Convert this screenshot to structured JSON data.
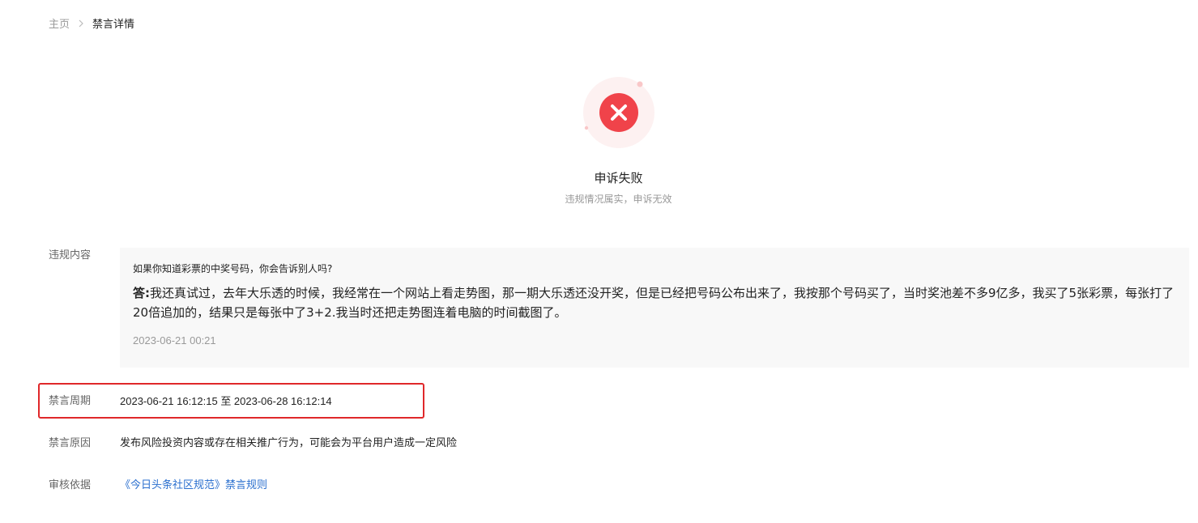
{
  "breadcrumb": {
    "home": "主页",
    "separator": ">",
    "current": "禁言详情"
  },
  "status": {
    "icon": "error-x-icon",
    "title": "申诉失败",
    "subtitle": "违规情况属实，申诉无效",
    "color": "#f0434a"
  },
  "violation": {
    "label": "违规内容",
    "question": "如果你知道彩票的中奖号码，你会告诉别人吗?",
    "answer_prefix": "答:",
    "answer_text": "我还真试过，去年大乐透的时候，我经常在一个网站上看走势图，那一期大乐透还没开奖，但是已经把号码公布出来了，我按那个号码买了，当时奖池差不多9亿多，我买了5张彩票，每张打了20倍追加的，结果只是每张中了3+2.我当时还把走势图连着电脑的时间截图了。",
    "date": "2023-06-21 00:21"
  },
  "ban_period": {
    "label": "禁言周期",
    "value": "2023-06-21 16:12:15 至 2023-06-28 16:12:14",
    "highlight_color": "#e0282a"
  },
  "ban_reason": {
    "label": "禁言原因",
    "value": "发布风险投资内容或存在相关推广行为，可能会为平台用户造成一定风险"
  },
  "review_basis": {
    "label": "审核依据",
    "link_text": "《今日头条社区规范》禁言规则",
    "link_color": "#2a6fcf"
  }
}
